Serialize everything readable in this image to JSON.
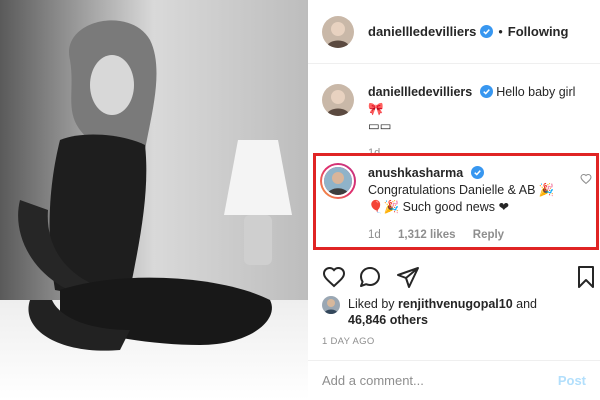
{
  "header": {
    "username": "daniellledevilliers",
    "separator": "•",
    "follow_status": "Following"
  },
  "caption": {
    "username": "daniellledevilliers",
    "text": "Hello baby girl 🎀",
    "text_line2": "▭▭",
    "time": "1d"
  },
  "comment": {
    "username": "anushkasharma",
    "text_line1": "Congratulations Danielle & AB 🎉",
    "text_line2": "🎈🎉 Such good news ❤",
    "time": "1d",
    "likes": "1,312 likes",
    "reply": "Reply"
  },
  "likes": {
    "prefix": "Liked by",
    "user": "renjithvenugopal10",
    "connector": "and",
    "others": "46,846 others"
  },
  "timestamp": "1 DAY AGO",
  "add_comment": {
    "placeholder": "Add a comment...",
    "post_label": "Post"
  },
  "colors": {
    "verified": "#3897f0",
    "highlight": "#e02424",
    "muted": "#8e8e8e",
    "post_disabled": "#b2dffc"
  },
  "icons": {
    "verified": "verified-badge-icon",
    "like": "heart-icon",
    "comment": "comment-icon",
    "share": "paper-plane-icon",
    "save": "bookmark-icon"
  }
}
